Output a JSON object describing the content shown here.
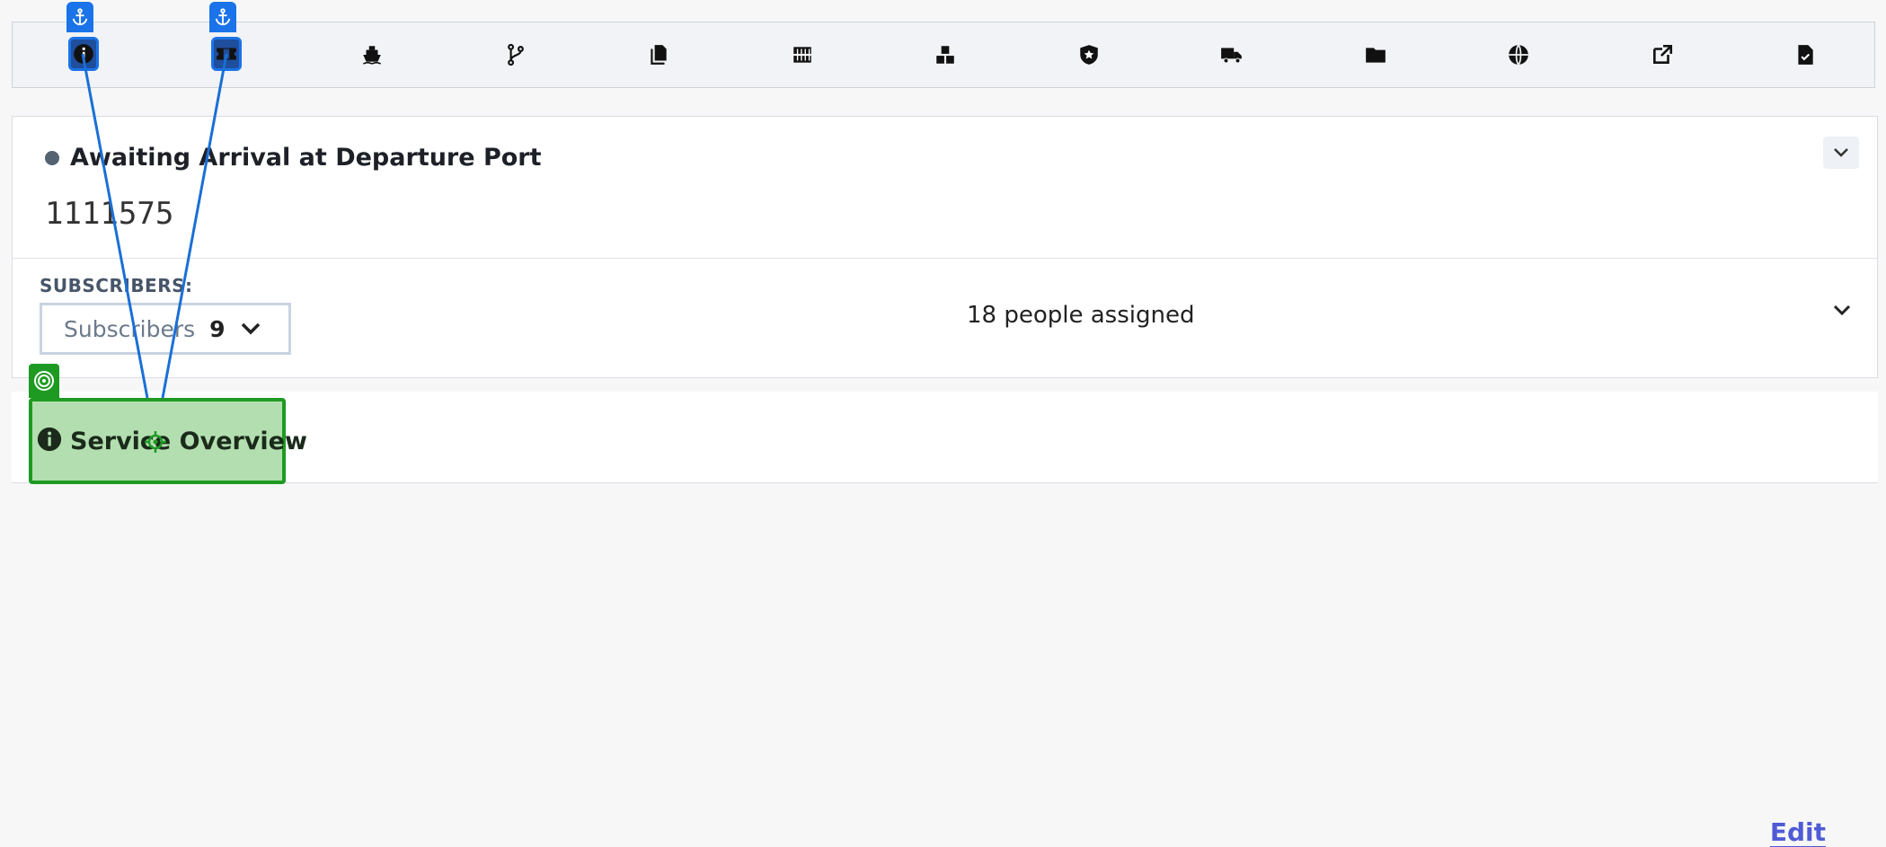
{
  "toolbar": {
    "icons": [
      {
        "name": "info-icon",
        "selected": true
      },
      {
        "name": "ticket-icon",
        "selected": true
      },
      {
        "name": "ship-icon",
        "selected": false
      },
      {
        "name": "branch-icon",
        "selected": false
      },
      {
        "name": "documents-icon",
        "selected": false
      },
      {
        "name": "container-icon",
        "selected": false
      },
      {
        "name": "boxes-icon",
        "selected": false
      },
      {
        "name": "shield-star-icon",
        "selected": false
      },
      {
        "name": "truck-icon",
        "selected": false
      },
      {
        "name": "folder-icon",
        "selected": false
      },
      {
        "name": "globe-icon",
        "selected": false
      },
      {
        "name": "external-link-icon",
        "selected": false
      },
      {
        "name": "file-check-icon",
        "selected": false
      }
    ]
  },
  "shipment": {
    "status": "Awaiting Arrival at Departure Port",
    "status_color": "#556270",
    "reference": "1111575"
  },
  "subscribers": {
    "label": "SUBSCRIBERS:",
    "dropdown_label": "Subscribers",
    "count": "9",
    "assigned_text": "18 people assigned"
  },
  "overview": {
    "title": "Service Overview",
    "edit_label": "Edit"
  },
  "colors": {
    "selection_blue": "#1a73e8",
    "highlight_green": "#1e9a22",
    "link": "#4f5bd5"
  }
}
